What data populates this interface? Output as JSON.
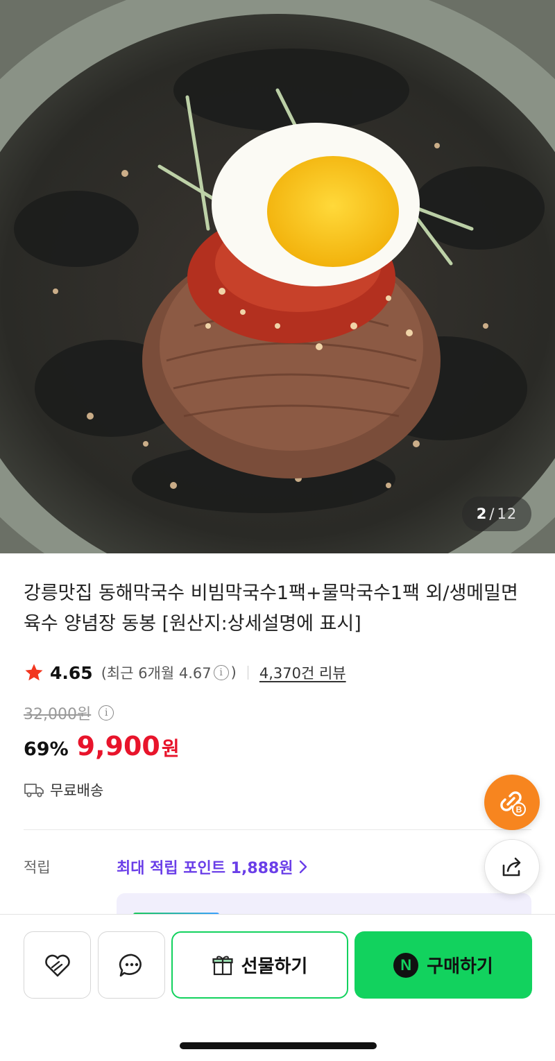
{
  "gallery": {
    "current": "2",
    "separator": "/",
    "total": "12"
  },
  "product": {
    "title": "강릉맛집 동해막국수 비빔막국수1팩+물막국수1팩 외/생메밀면 육수 양념장 동봉 [원산지:상세설명에 표시]"
  },
  "rating": {
    "icon": "star-icon",
    "score": "4.65",
    "recent_label": "(최근 6개월 4.67",
    "recent_close": ")",
    "info_glyph": "i",
    "review_count": "4,370건 리뷰"
  },
  "price": {
    "original": "32,000원",
    "discount": "69%",
    "sale_amount": "9,900",
    "sale_unit": "원"
  },
  "shipping": {
    "icon": "truck-icon",
    "label": "무료배송"
  },
  "reward": {
    "label": "적립",
    "value": "최대 적립 포인트 1,888원"
  },
  "floating": {
    "link_icon": "link-b-icon",
    "share_icon": "share-icon"
  },
  "bottom_bar": {
    "wish_icon": "heart-icon",
    "chat_icon": "chat-bubble-icon",
    "gift_label": "선물하기",
    "npay_glyph": "N",
    "buy_label": "구매하기"
  },
  "colors": {
    "sale_red": "#e8142b",
    "naver_green": "#12d25e",
    "reward_purple": "#6a3ee8",
    "link_orange": "#f7851f"
  }
}
